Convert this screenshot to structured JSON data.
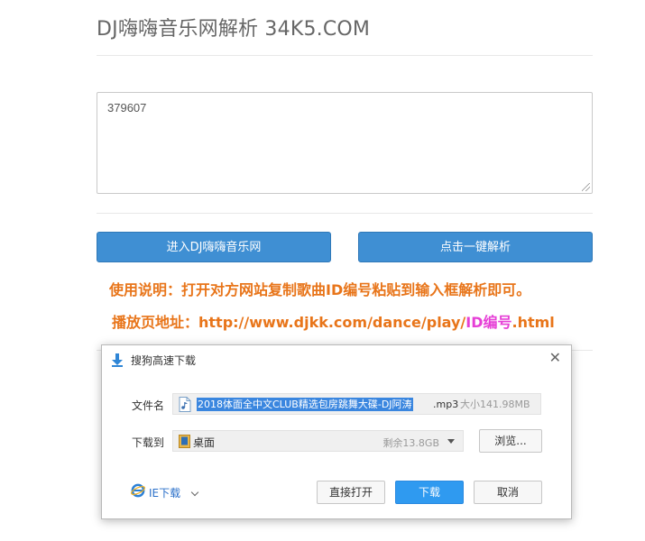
{
  "page": {
    "title": "DJ嗨嗨音乐网解析 34K5.COM",
    "input_value": "379607",
    "button_enter": "进入DJ嗨嗨音乐网",
    "button_parse": "点击一键解析",
    "usage": "使用说明：打开对方网站复制歌曲ID编号粘贴到输入框解析即可。",
    "playurl_prefix": "播放页地址：http://www.djkk.com/dance/play/",
    "playurl_id": "ID编号",
    "playurl_suffix": ".html"
  },
  "dialog": {
    "title": "搜狗高速下载",
    "file_label": "文件名",
    "file_name": "2018体面全中文CLUB精选包房跳舞大碟-DJ阿涛",
    "file_ext": ".mp3",
    "file_size": "大小141.98MB",
    "dir_label": "下载到",
    "dir_name": "桌面",
    "dir_free": "剩余13.8GB",
    "browse_button": "浏览...",
    "ie_download": "IE下载",
    "open_button": "直接打开",
    "download_button": "下载",
    "cancel_button": "取消"
  },
  "colors": {
    "button_blue": "#3f8fd3",
    "usage_orange": "#e8751a",
    "id_magenta": "#e63fd6",
    "download_blue": "#2f9af0"
  }
}
